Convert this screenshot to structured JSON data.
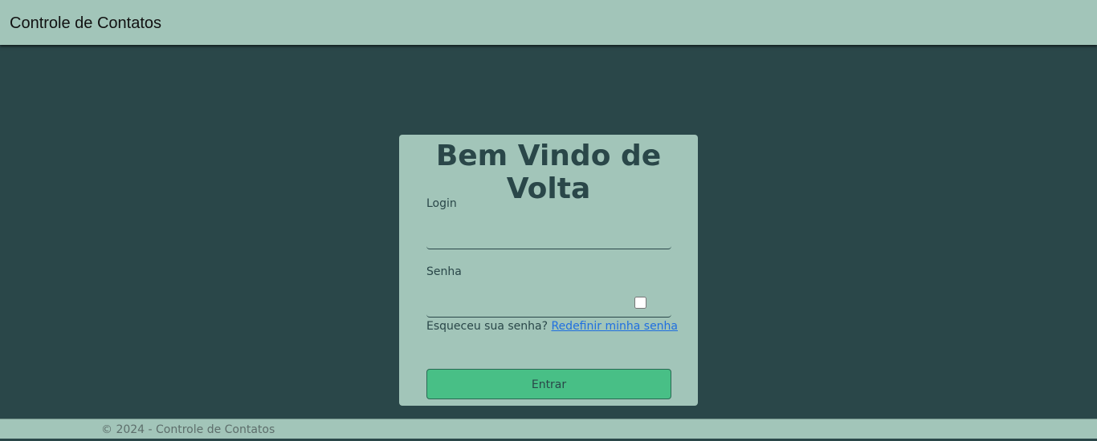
{
  "navbar": {
    "brand": "Controle de Contatos"
  },
  "login_card": {
    "title": "Bem Vindo de Volta",
    "login_label": "Login",
    "login_value": "",
    "password_label": "Senha",
    "password_value": "",
    "show_password_checked": false,
    "forgot_text": "Esqueceu sua senha?",
    "reset_link": "Redefinir minha senha",
    "submit_label": "Entrar"
  },
  "footer": {
    "text": "© 2024 - Controle de Contatos"
  },
  "colors": {
    "background": "#2a4749",
    "panel": "#a2c5b9",
    "primary_button": "#48bf86",
    "link": "#1f6fe0"
  }
}
